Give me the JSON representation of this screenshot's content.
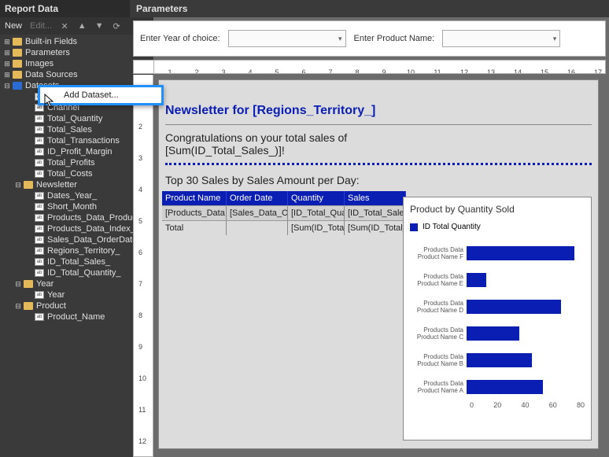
{
  "sidebar": {
    "title": "Report Data",
    "new_label": "New",
    "edit_label": "Edit...",
    "folders": {
      "builtin": "Built-in Fields",
      "parameters": "Parameters",
      "images": "Images",
      "datasources": "Data Sources",
      "datasets": "Datasets"
    },
    "dataset_fields": [
      "Year",
      "Channel",
      "Total_Quantity",
      "Total_Sales",
      "Total_Transactions",
      "ID_Profit_Margin",
      "Total_Profits",
      "Total_Costs"
    ],
    "newsletter_label": "Newsletter",
    "newsletter_fields": [
      "Dates_Year_",
      "Short_Month",
      "Products_Data_Product",
      "Products_Data_Index_",
      "Sales_Data_OrderDate_",
      "Regions_Territory_",
      "ID_Total_Sales_",
      "ID_Total_Quantity_"
    ],
    "year_ds_label": "Year",
    "year_fields": [
      "Year"
    ],
    "product_ds_label": "Product",
    "product_fields": [
      "Product_Name"
    ],
    "context_menu": {
      "add_dataset": "Add Dataset..."
    }
  },
  "params": {
    "header": "Parameters",
    "year_label": "Enter Year of choice:",
    "product_label": "Enter Product Name:"
  },
  "ruler": [
    "1",
    "2",
    "3",
    "4",
    "5",
    "6",
    "7",
    "8",
    "9",
    "10",
    "11",
    "12",
    "13",
    "14",
    "15",
    "16",
    "17"
  ],
  "vruler": [
    "1",
    "2",
    "3",
    "4",
    "5",
    "6",
    "7",
    "8",
    "9",
    "10",
    "11",
    "12"
  ],
  "report": {
    "headline": "Newsletter for [Regions_Territory_]",
    "congrats_line1": "Congratulations on your total sales of",
    "congrats_line2": "[Sum(ID_Total_Sales_)]!",
    "subhead": "Top 30 Sales by Sales Amount per Day:",
    "table": {
      "headers": [
        "Product Name",
        "Order Date",
        "Quantity",
        "Sales"
      ],
      "row1": [
        "[Products_Data",
        "[Sales_Data_Or",
        "[ID_Total_Quant",
        "[ID_Total_Sales"
      ],
      "row2": [
        "Total",
        "",
        "[Sum(ID_Total_Q",
        "[Sum(ID_Total_"
      ]
    }
  },
  "chart_data": {
    "type": "bar",
    "title": "Product by Quantity Sold",
    "legend": "ID Total Quantity",
    "categories": [
      "Products Data Product Name F",
      "Products Data Product Name E",
      "Products Data Product Name D",
      "Products Data Product Name C",
      "Products Data Product Name B",
      "Products Data Product Name A"
    ],
    "values": [
      82,
      15,
      72,
      40,
      50,
      58
    ],
    "xlabel": "",
    "ylabel": "",
    "xlim": [
      0,
      90
    ],
    "axis_ticks": [
      "0",
      "20",
      "40",
      "60",
      "80"
    ]
  }
}
